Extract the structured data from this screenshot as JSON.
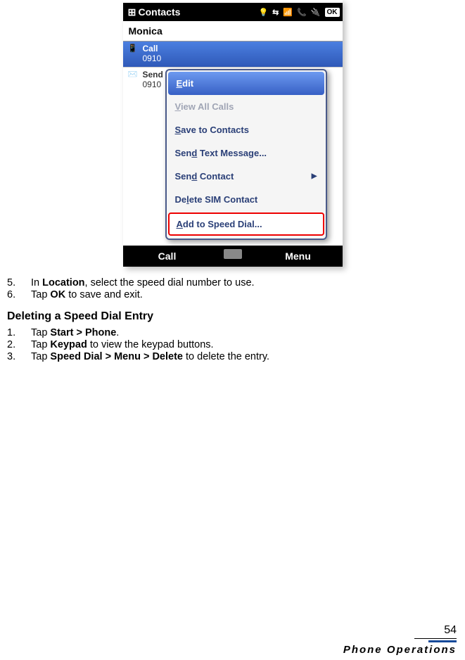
{
  "device": {
    "title": "Contacts",
    "status_icons": [
      "💡",
      "⇆",
      "📶",
      "📞",
      "🔌"
    ],
    "ok": "OK",
    "contact_name": "Monica",
    "entries": [
      {
        "label": "Call",
        "number": "0910"
      },
      {
        "label": "Send",
        "number": "0910"
      }
    ],
    "menu": {
      "items": [
        {
          "text_pre": "",
          "u": "E",
          "text_post": "dit",
          "state": "active"
        },
        {
          "text_pre": "",
          "u": "V",
          "text_post": "iew All Calls",
          "state": "disabled"
        },
        {
          "text_pre": "",
          "u": "S",
          "text_post": "ave to Contacts",
          "state": ""
        },
        {
          "text_pre": "Sen",
          "u": "d",
          "text_post": " Text Message...",
          "state": ""
        },
        {
          "text_pre": "Sen",
          "u": "d",
          "text_post": " Contact",
          "state": "",
          "arrow": true
        },
        {
          "text_pre": "De",
          "u": "l",
          "text_post": "ete SIM Contact",
          "state": ""
        },
        {
          "text_pre": "",
          "u": "A",
          "text_post": "dd to Speed Dial...",
          "state": "highlight"
        }
      ]
    },
    "softkeys": {
      "left": "Call",
      "right": "Menu"
    }
  },
  "doc": {
    "step5": {
      "num": "5.",
      "a": "In ",
      "b": "Location",
      "c": ", select the speed dial number to use."
    },
    "step6": {
      "num": "6.",
      "a": "Tap ",
      "b": "OK",
      "c": " to save and exit."
    },
    "section": "Deleting a Speed Dial Entry",
    "d1": {
      "num": "1.",
      "a": "Tap ",
      "b": "Start > Phone",
      "c": "."
    },
    "d2": {
      "num": "2.",
      "a": "Tap ",
      "b": "Keypad",
      "c": " to view the keypad buttons."
    },
    "d3": {
      "num": "3.",
      "a": "Tap ",
      "b": "Speed Dial > Menu > Delete",
      "c": " to delete the entry."
    }
  },
  "footer": {
    "page": "54",
    "title": "Phone Operations"
  }
}
